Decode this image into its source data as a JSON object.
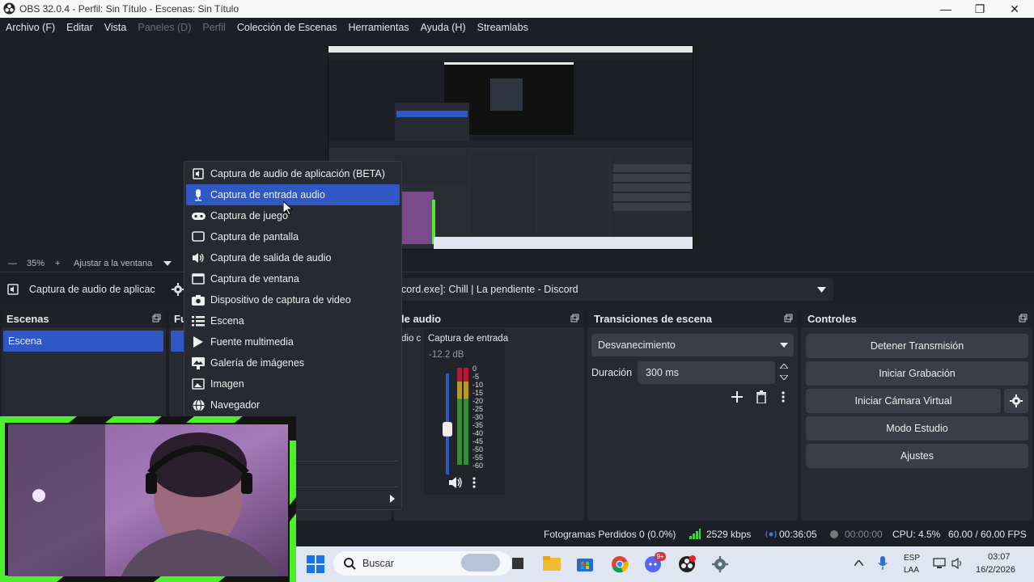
{
  "window": {
    "title": "OBS 32.0.4 - Perfil: Sin Título - Escenas: Sin Título"
  },
  "menu": [
    "Archivo (F)",
    "Editar",
    "Vista",
    "Paneles (D)",
    "Perfil",
    "Colección de Escenas",
    "Herramientas",
    "Ayuda (H)",
    "Streamlabs"
  ],
  "zoom": {
    "value": "35%",
    "fit_label": "Ajustar a la ventana"
  },
  "source_bar": {
    "source_name": "Captura de audio de aplicac",
    "selected_window": "cord.exe]: Chill | La pendiente - Discord"
  },
  "context_menu": {
    "items": [
      {
        "label": "Captura de audio de aplicación (BETA)",
        "icon": "app-audio-icon"
      },
      {
        "label": "Captura de entrada audio",
        "icon": "microphone-icon",
        "selected": true
      },
      {
        "label": "Captura de juego",
        "icon": "gamepad-icon"
      },
      {
        "label": "Captura de pantalla",
        "icon": "monitor-icon"
      },
      {
        "label": "Captura de salida de audio",
        "icon": "speaker-icon"
      },
      {
        "label": "Captura de ventana",
        "icon": "window-icon"
      },
      {
        "label": "Dispositivo de captura de video",
        "icon": "camera-icon"
      },
      {
        "label": "Escena",
        "icon": "list-icon"
      },
      {
        "label": "Fuente multimedia",
        "icon": "play-icon"
      },
      {
        "label": "Galería de imágenes",
        "icon": "image-gallery-icon"
      },
      {
        "label": "Imagen",
        "icon": "image-icon"
      },
      {
        "label": "Navegador",
        "icon": "globe-icon"
      }
    ]
  },
  "scenes": {
    "title": "Escenas",
    "items": [
      "Escena"
    ]
  },
  "sources": {
    "title_fragment": "Fu"
  },
  "audio_mixer": {
    "title_fragment": "le audio",
    "left_fragment": "dio c",
    "channel_name": "Captura de entrada",
    "level": "-12.2 dB",
    "meter_ticks": [
      "0",
      "-5",
      "-10",
      "-15",
      "-20",
      "-25",
      "-30",
      "-35",
      "-40",
      "-45",
      "-50",
      "-55",
      "-60"
    ],
    "volume_level": 0.45
  },
  "transitions": {
    "title": "Transiciones de escena",
    "selected": "Desvanecimiento",
    "duration_label": "Duración",
    "duration_value": "300 ms"
  },
  "controls": {
    "title": "Controles",
    "buttons": [
      "Detener Transmisión",
      "Iniciar Grabación",
      "Iniciar Cámara Virtual",
      "Modo Estudio",
      "Ajustes"
    ]
  },
  "status": {
    "dropped_frames": "Fotogramas Perdidos 0 (0.0%)",
    "bitrate": "2529 kbps",
    "stream_time": "00:36:05",
    "rec_time": "00:00:00",
    "cpu": "CPU: 4.5%",
    "fps": "60.00 / 60.00 FPS"
  },
  "taskbar": {
    "search_placeholder": "Buscar",
    "lang_top": "ESP",
    "lang_bottom": "LAA",
    "time": "03:07",
    "date": "16/2/2026",
    "discord_badge": "9+"
  },
  "colors": {
    "accent": "#2f58c5",
    "panel": "#272a33",
    "background": "#1d1f26",
    "button": "#3b3e48",
    "webcam_border": "#4cf02a"
  }
}
